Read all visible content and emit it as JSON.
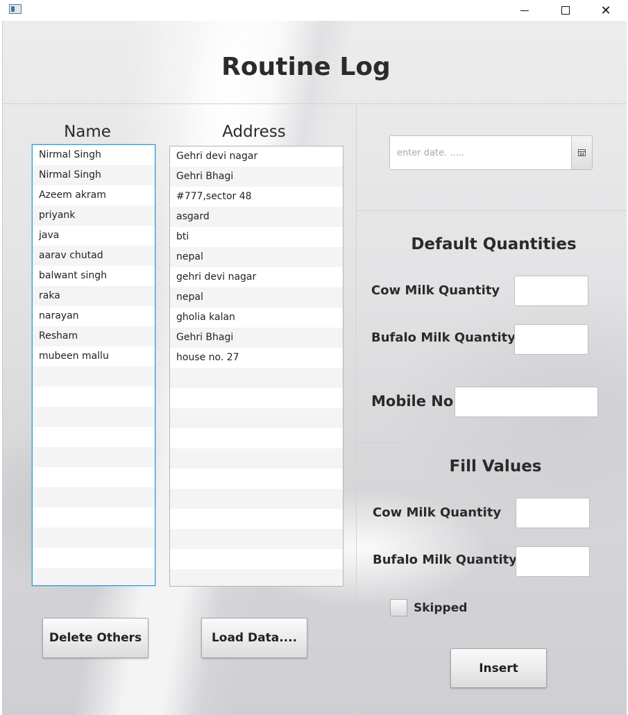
{
  "window": {
    "icon": "app-window-icon",
    "controls": {
      "minimize": "minimize",
      "maximize": "maximize",
      "close": "✕"
    }
  },
  "title": "Routine Log",
  "names": {
    "heading": "Name",
    "items": [
      "Nirmal Singh",
      "Nirmal Singh",
      "Azeem akram",
      "priyank",
      "java",
      "aarav chutad",
      "balwant singh",
      "raka",
      "narayan",
      "Resham",
      "mubeen mallu",
      "",
      "",
      "",
      "",
      "",
      "",
      "",
      "",
      "",
      "",
      ""
    ]
  },
  "addresses": {
    "heading": "Address",
    "items": [
      "Gehri devi nagar",
      "Gehri Bhagi",
      "#777,sector 48",
      "asgard",
      "bti",
      "nepal",
      "gehri devi nagar",
      "nepal",
      "gholia kalan",
      "Gehri Bhagi",
      "house no. 27",
      "",
      "",
      "",
      "",
      "",
      "",
      "",
      "",
      "",
      "",
      ""
    ]
  },
  "buttons": {
    "delete_others": "Delete Others",
    "load_data": "Load Data....",
    "insert": "Insert"
  },
  "date": {
    "placeholder": "enter date. .....",
    "value": "",
    "icon": "calendar-icon"
  },
  "default_quantities": {
    "heading": "Default Quantities",
    "cow_label": "Cow Milk Quantity",
    "bufalo_label": "Bufalo Milk Quantity",
    "cow_value": "",
    "bufalo_value": "",
    "mobile_label": "Mobile No.",
    "mobile_value": ""
  },
  "fill_values": {
    "heading": "Fill Values",
    "cow_label": "Cow Milk Quantity",
    "bufalo_label": "Bufalo Milk Quantity",
    "cow_value": "",
    "bufalo_value": "",
    "skipped_label": "Skipped",
    "skipped_checked": false
  }
}
